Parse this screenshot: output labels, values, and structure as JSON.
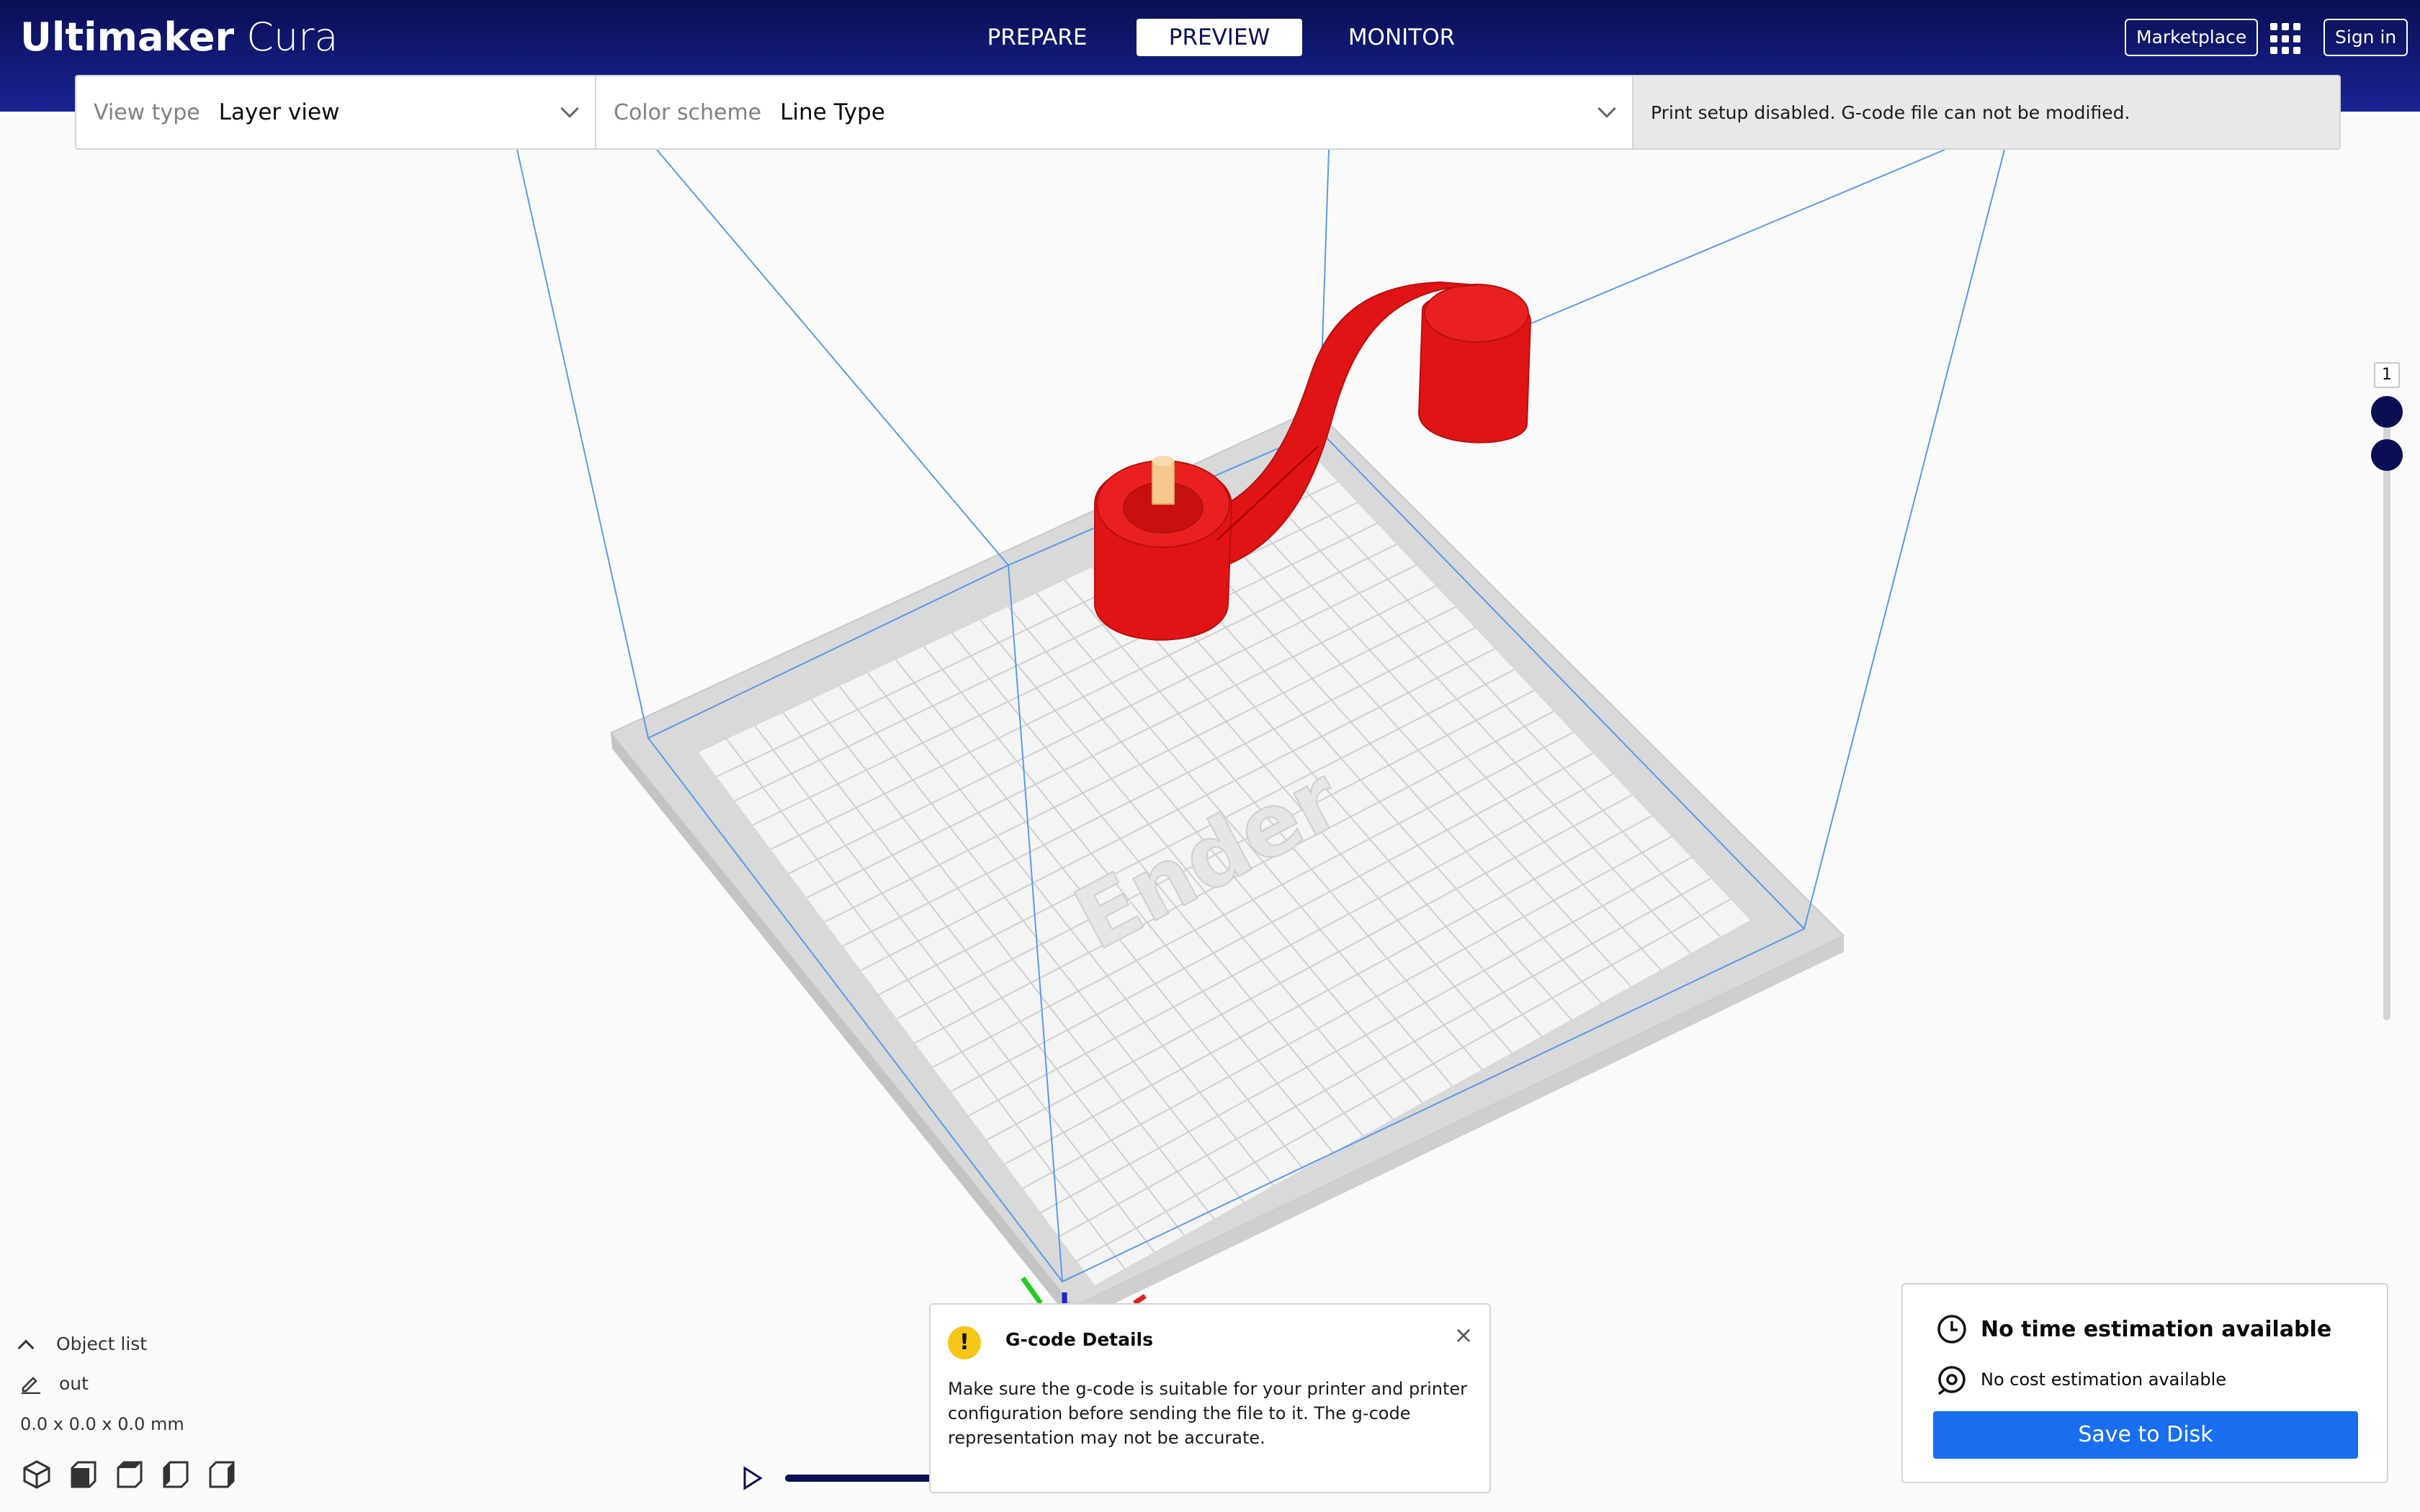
{
  "app": {
    "brand_bold": "Ultimaker",
    "brand_light": "Cura"
  },
  "stages": [
    {
      "label": "PREPARE",
      "active": false
    },
    {
      "label": "PREVIEW",
      "active": true
    },
    {
      "label": "MONITOR",
      "active": false
    }
  ],
  "header": {
    "marketplace_label": "Marketplace",
    "signin_label": "Sign in"
  },
  "viewbar": {
    "view_type_label": "View type",
    "view_type_value": "Layer view",
    "color_scheme_label": "Color scheme",
    "color_scheme_value": "Line Type",
    "message": "Print setup disabled. G-code file can not be modified."
  },
  "layer_slider": {
    "current_layer": "1"
  },
  "object_list": {
    "title": "Object list",
    "item_name": "out",
    "dimensions": "0.0 x 0.0 x 0.0 mm"
  },
  "view_icons": [
    "3d-view-icon",
    "front-view-icon",
    "top-view-icon",
    "left-view-icon",
    "right-view-icon"
  ],
  "gcode_popup": {
    "title": "G-code Details",
    "warning_symbol": "!",
    "close_symbol": "×",
    "body": "Make sure the g-code is suitable for your printer and printer configuration before sending the file to it. The g-code representation may not be accurate."
  },
  "estimation": {
    "time_text": "No time estimation available",
    "cost_text": "No cost estimation available",
    "save_label": "Save to Disk"
  },
  "colors": {
    "header_dark": "#0a0f54",
    "accent_blue": "#196ef0",
    "model_red": "#e01414",
    "build_volume_line": "#4a90e2"
  }
}
